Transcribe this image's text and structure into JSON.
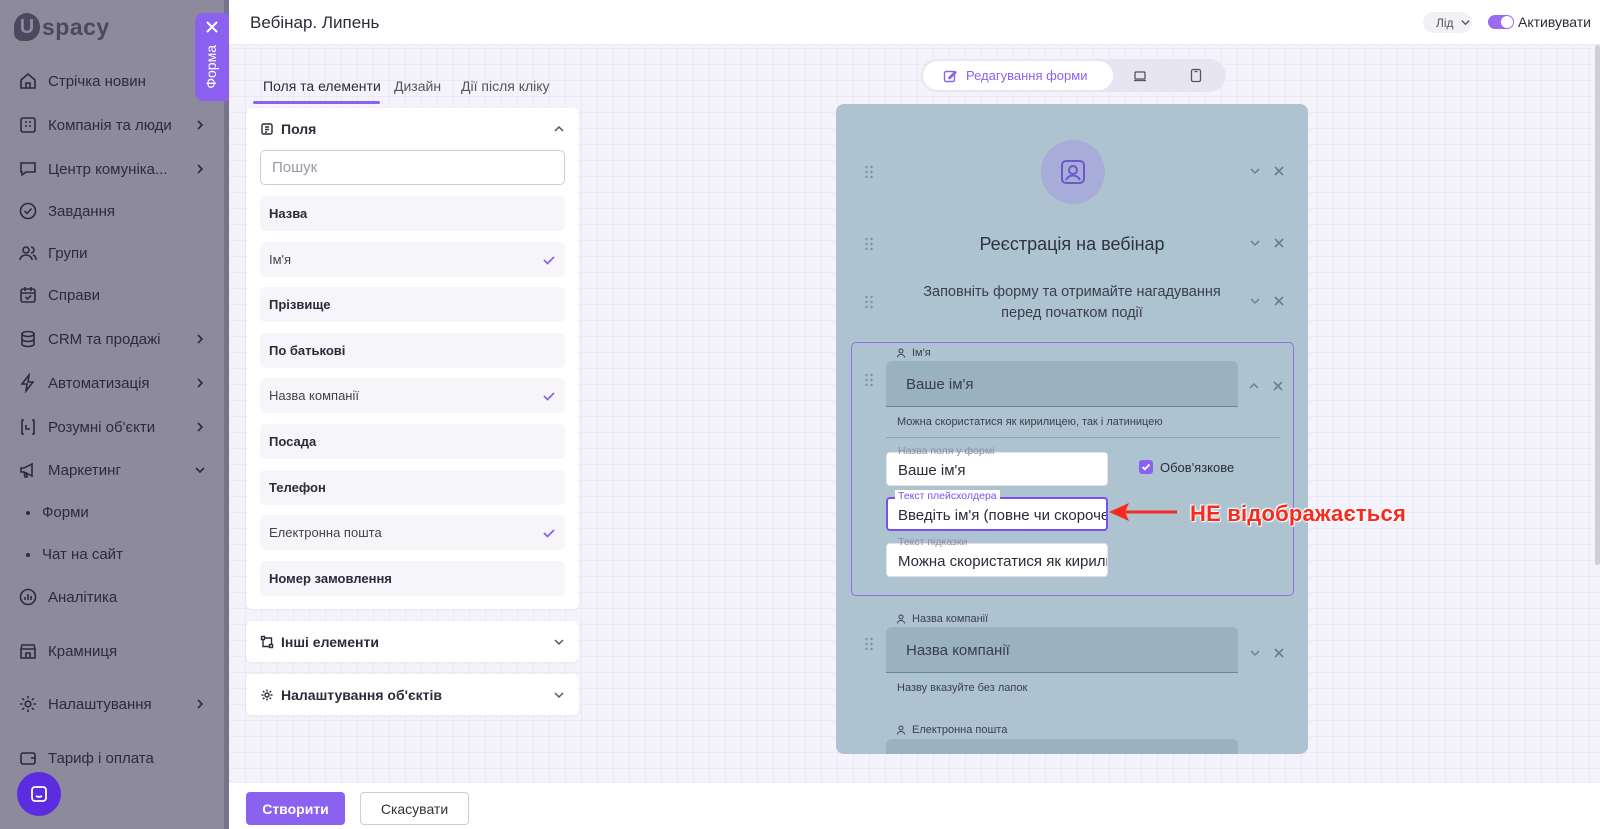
{
  "sidebar": {
    "logo_letter": "U",
    "logo_text": "spacy",
    "items": [
      {
        "label": "Стрічка новин",
        "icon": "home-icon"
      },
      {
        "label": "Компанія та люди",
        "icon": "building-icon"
      },
      {
        "label": "Центр комуніка...",
        "icon": "chat-icon"
      },
      {
        "label": "Завдання",
        "icon": "check-circle-icon"
      },
      {
        "label": "Групи",
        "icon": "users-icon"
      },
      {
        "label": "Справи",
        "icon": "calendar-icon"
      },
      {
        "label": "CRM та продажі",
        "icon": "database-icon"
      },
      {
        "label": "Автоматизація",
        "icon": "lightning-icon"
      },
      {
        "label": "Розумні об'єкти",
        "icon": "brackets-icon"
      },
      {
        "label": "Маркетинг",
        "icon": "megaphone-icon"
      },
      {
        "label": "Аналітика",
        "icon": "chart-icon"
      },
      {
        "label": "Крамниця",
        "icon": "store-icon"
      },
      {
        "label": "Налаштування",
        "icon": "gear-icon"
      },
      {
        "label": "Тариф і оплата",
        "icon": "wallet-icon"
      }
    ],
    "sub_items": [
      "Форми",
      "Чат на сайт"
    ]
  },
  "forma_tab": {
    "label": "Форма"
  },
  "header": {
    "title": "Вебінар. Липень",
    "entity_select": "Лід",
    "activate_label": "Активувати"
  },
  "tabs": [
    "Поля та елементи",
    "Дизайн",
    "Дії після кліку"
  ],
  "fields_panel": {
    "title": "Поля",
    "search_placeholder": "Пошук",
    "fields": [
      {
        "label": "Назва",
        "checked": false
      },
      {
        "label": "Ім'я",
        "checked": true
      },
      {
        "label": "Прізвище",
        "checked": false
      },
      {
        "label": "По батькові",
        "checked": false
      },
      {
        "label": "Назва компанії",
        "checked": true
      },
      {
        "label": "Посада",
        "checked": false
      },
      {
        "label": "Телефон",
        "checked": false
      },
      {
        "label": "Електронна пошта",
        "checked": true
      },
      {
        "label": "Номер замовлення",
        "checked": false
      }
    ]
  },
  "other_panel": {
    "title": "Інші елементи"
  },
  "settings_panel": {
    "title": "Налаштування об'єктів"
  },
  "view_switch": {
    "edit_label": "Редагування форми"
  },
  "preview": {
    "heading": "Реєстрація на вебінар",
    "subtitle": "Заповніть форму та отримайте нагадування перед початком події",
    "name_field": {
      "label": "Ім'я",
      "placeholder": "Ваше ім'я",
      "help": "Можна скористатися як кирилицею, так і латиницею",
      "edit_name_label": "Назва поля у формі",
      "edit_name_value": "Ваше ім'я",
      "required_label": "Обов'язкове",
      "placeholder_label": "Текст плейсхолдера",
      "placeholder_value": "Введіть ім'я (повне чи скорочене)",
      "hint_label": "Текст підказки",
      "hint_value": "Можна скористатися як кирилицею, так і латиницею"
    },
    "company_field": {
      "label": "Назва компанії",
      "placeholder": "Назва компанії",
      "help": "Назву вказуйте без лапок"
    },
    "email_field": {
      "label": "Електронна пошта"
    }
  },
  "annotation": {
    "text": "НЕ відображається",
    "color": "#f52b1f"
  },
  "footer": {
    "create_label": "Створити",
    "cancel_label": "Скасувати"
  },
  "colors": {
    "accent": "#8b62ef",
    "preview_bg": "#adc3cf"
  }
}
